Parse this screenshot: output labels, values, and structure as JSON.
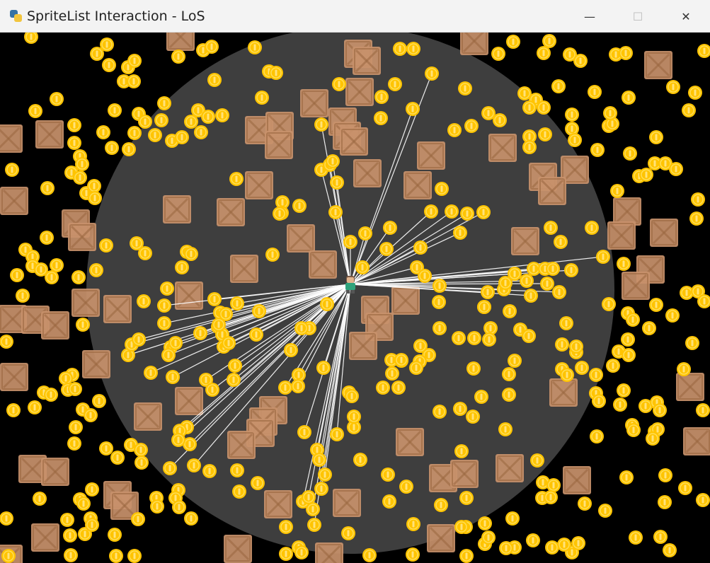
{
  "window": {
    "title": "SpriteList Interaction - LoS",
    "app_icon": "python-icon",
    "controls": [
      {
        "name": "minimize",
        "glyph": "—"
      },
      {
        "name": "maximize",
        "glyph": "☐"
      },
      {
        "name": "close",
        "glyph": "✕"
      }
    ]
  },
  "scene": {
    "background_color": "#000000",
    "los_circle_color": "#3e3e3e",
    "los_line_color": "#ffffff",
    "coin_color": "#ffc400",
    "coin_inner_color": "#ffdd55",
    "crate_color": "#c8916b",
    "crate_dark_color": "#9a6740",
    "sprite_types": [
      "coin",
      "crate",
      "player"
    ],
    "player_icon": "player-character-icon"
  }
}
